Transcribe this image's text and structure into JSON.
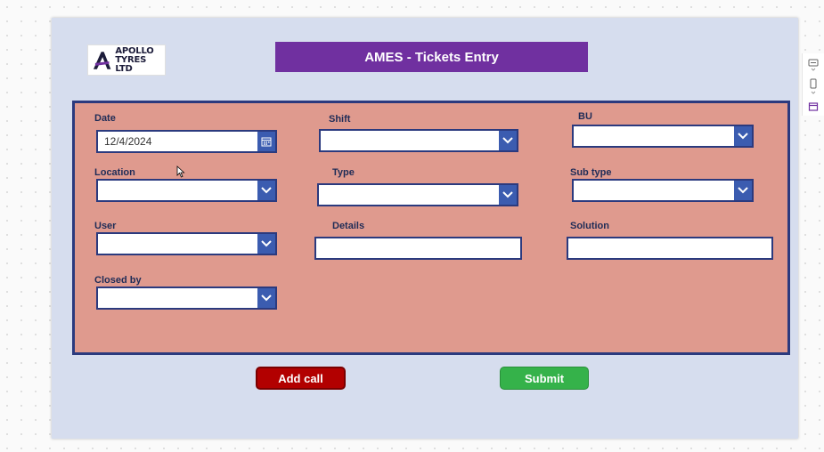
{
  "header": {
    "title": "AMES - Tickets Entry",
    "logo_text_line1": "APOLLO",
    "logo_text_line2": "TYRES LTD"
  },
  "form": {
    "date": {
      "label": "Date",
      "value": "12/4/2024"
    },
    "shift": {
      "label": "Shift",
      "value": ""
    },
    "bu": {
      "label": "BU",
      "value": ""
    },
    "location": {
      "label": "Location",
      "value": ""
    },
    "type": {
      "label": "Type",
      "value": ""
    },
    "sub_type": {
      "label": "Sub type",
      "value": ""
    },
    "user": {
      "label": "User",
      "value": ""
    },
    "details": {
      "label": "Details",
      "value": ""
    },
    "solution": {
      "label": "Solution",
      "value": ""
    },
    "closed_by": {
      "label": "Closed by",
      "value": ""
    }
  },
  "buttons": {
    "add_call": "Add call",
    "submit": "Submit"
  },
  "colors": {
    "title_bar": "#7030a0",
    "panel": "#df9a8e",
    "panel_border": "#2b3a7e",
    "dropdown_button": "#3b5cb0",
    "add_call": "#b20000",
    "submit": "#35b24a"
  },
  "icons": {
    "dropdown": "chevron-down-icon",
    "date_picker": "calendar-icon",
    "side_toolbar": [
      "comment-icon",
      "phone-icon",
      "calendar-icon"
    ]
  }
}
